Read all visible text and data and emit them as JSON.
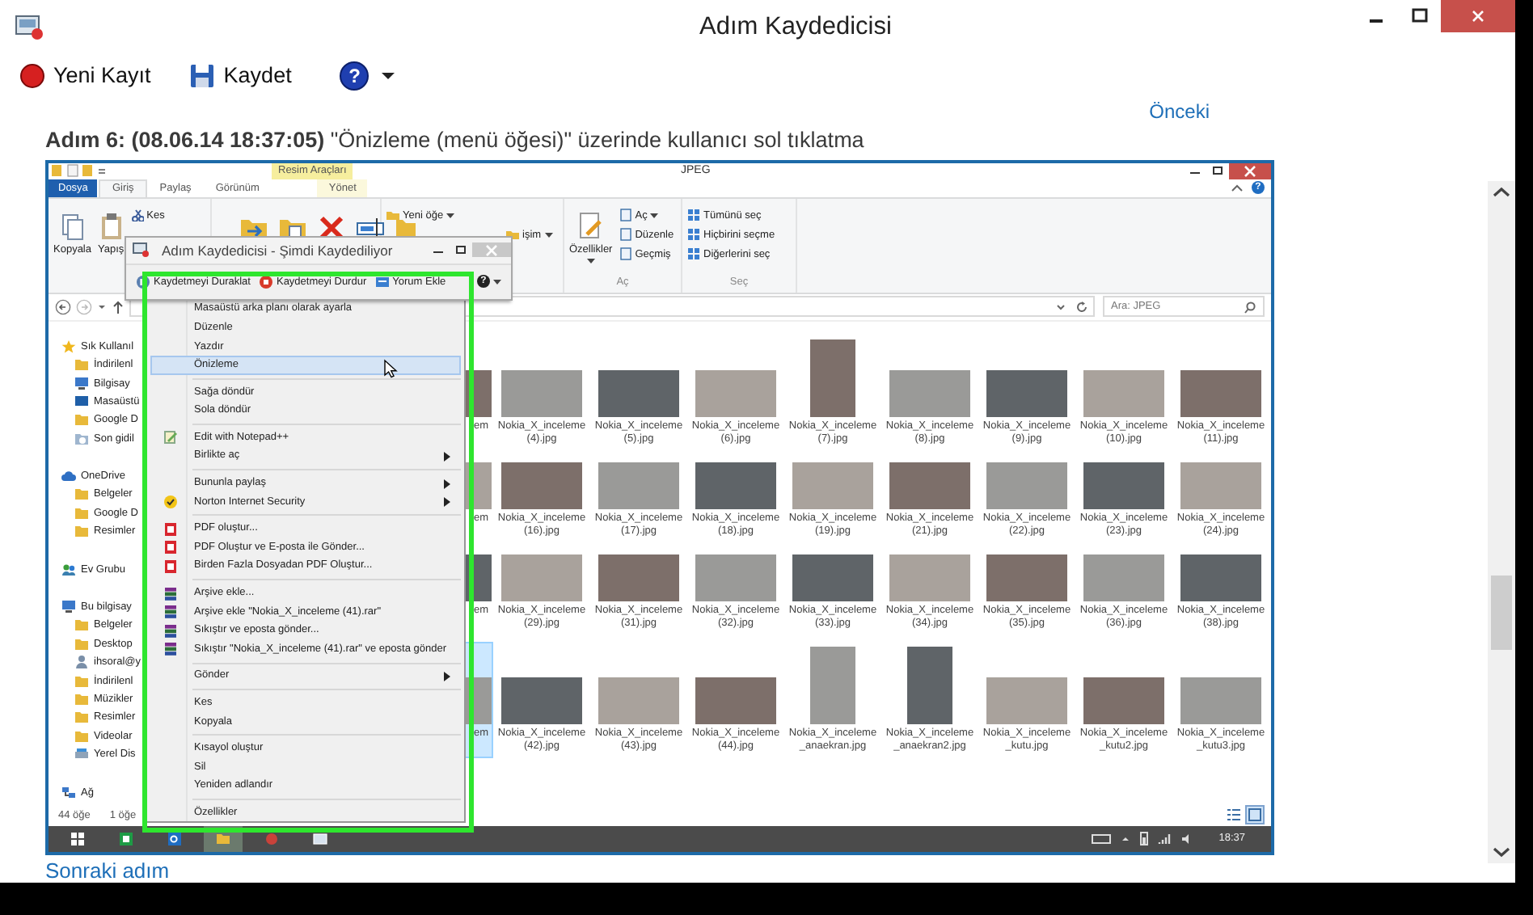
{
  "window": {
    "title": "Adım Kaydedicisi"
  },
  "toolbar": {
    "new_recording": "Yeni Kayıt",
    "save": "Kaydet",
    "help_symbol": "?"
  },
  "step": {
    "previous_link": "Önceki",
    "heading": "**Adım 6: (08.06.14 18:37:05)** \"Önizleme (menü öğesi)\" üzerinde kullanıcı sol tıklatma",
    "next_link": "Sonraki adım"
  },
  "screenshot": {
    "explorer": {
      "title": "JPEG",
      "context_tab": "Resim Araçları",
      "help_symbol": "?",
      "tabs": [
        {
          "label": "Dosya",
          "kind": "file",
          "selected": false
        },
        {
          "label": "Giriş",
          "kind": "tab",
          "selected": true
        },
        {
          "label": "Paylaş",
          "kind": "tab",
          "selected": false
        },
        {
          "label": "Görünüm",
          "kind": "tab",
          "selected": false
        },
        {
          "label": "Yönet",
          "kind": "context",
          "selected": false
        }
      ],
      "ribbon": [
        {
          "kind": "clipboard",
          "items": [
            {
              "label": "Kopyala",
              "kind": "large",
              "dropdown": false
            },
            {
              "label": "Yapış",
              "kind": "large",
              "dropdown": false
            },
            {
              "label": "Kes",
              "kind": "small",
              "dropdown": false
            }
          ]
        },
        {
          "kind": "organize"
        },
        {
          "kind": "new",
          "items": [
            {
              "label": "Yeni öğe",
              "kind": "small",
              "dropdown": true
            },
            {
              "label": "işim",
              "kind": "small",
              "dropdown": true
            }
          ]
        },
        {
          "kind": "open",
          "caption": "Aç",
          "items": [
            {
              "label": "Özellikler",
              "kind": "large",
              "dropdown": true
            },
            {
              "label": "Aç",
              "kind": "small",
              "dropdown": true
            },
            {
              "label": "Düzenle",
              "kind": "small",
              "dropdown": false
            },
            {
              "label": "Geçmiş",
              "kind": "small",
              "dropdown": false
            }
          ]
        },
        {
          "kind": "select",
          "caption": "Seç",
          "items": [
            {
              "label": "Tümünü seç",
              "kind": "small",
              "dropdown": false
            },
            {
              "label": "Hiçbirini seçme",
              "kind": "small",
              "dropdown": false
            },
            {
              "label": "Diğerlerini seç",
              "kind": "small",
              "dropdown": false
            }
          ]
        }
      ],
      "search_placeholder": "Ara: JPEG",
      "navigation": [
        {
          "label": "Sık Kullanıl",
          "kind": "star",
          "children": [
            {
              "label": "İndirilenl",
              "kind": "folder"
            },
            {
              "label": "Bilgisay",
              "kind": "computer"
            },
            {
              "label": "Masaüstü",
              "kind": "desktop"
            },
            {
              "label": "Google D",
              "kind": "folder"
            },
            {
              "label": "Son gidil",
              "kind": "recent"
            }
          ]
        },
        {
          "label": "OneDrive",
          "kind": "cloud",
          "children": [
            {
              "label": "Belgeler",
              "kind": "folder"
            },
            {
              "label": "Google D",
              "kind": "folder"
            },
            {
              "label": "Resimler",
              "kind": "folder"
            }
          ]
        },
        {
          "label": "Ev Grubu",
          "kind": "group"
        },
        {
          "label": "Bu bilgisay",
          "kind": "computer",
          "children": [
            {
              "label": "Belgeler",
              "kind": "folder"
            },
            {
              "label": "Desktop",
              "kind": "folder"
            },
            {
              "label": "ihsoral@y",
              "kind": "user"
            },
            {
              "label": "İndirilenl",
              "kind": "folder"
            },
            {
              "label": "Müzikler",
              "kind": "folder"
            },
            {
              "label": "Resimler",
              "kind": "folder"
            },
            {
              "label": "Videolar",
              "kind": "folder"
            },
            {
              "label": "Yerel Dis",
              "kind": "drive"
            }
          ]
        },
        {
          "label": "Ağ",
          "kind": "network"
        }
      ],
      "files": [
        [
          {
            "label": "em",
            "kind": "peek",
            "selected": false
          },
          {
            "label": "Nokia_X_inceleme (4).jpg",
            "kind": "landscape",
            "selected": false
          },
          {
            "label": "Nokia_X_inceleme (5).jpg",
            "kind": "landscape",
            "selected": false
          },
          {
            "label": "Nokia_X_inceleme (6).jpg",
            "kind": "landscape",
            "selected": false
          },
          {
            "label": "Nokia_X_inceleme (7).jpg",
            "kind": "portrait",
            "selected": false
          },
          {
            "label": "Nokia_X_inceleme (8).jpg",
            "kind": "landscape",
            "selected": false
          },
          {
            "label": "Nokia_X_inceleme (9).jpg",
            "kind": "landscape",
            "selected": false
          },
          {
            "label": "Nokia_X_inceleme (10).jpg",
            "kind": "landscape",
            "selected": false
          },
          {
            "label": "Nokia_X_inceleme (11).jpg",
            "kind": "landscape",
            "selected": false
          }
        ],
        [
          {
            "label": "em",
            "kind": "peek",
            "selected": false
          },
          {
            "label": "Nokia_X_inceleme (16).jpg",
            "kind": "landscape",
            "selected": false
          },
          {
            "label": "Nokia_X_inceleme (17).jpg",
            "kind": "landscape",
            "selected": false
          },
          {
            "label": "Nokia_X_inceleme (18).jpg",
            "kind": "landscape",
            "selected": false
          },
          {
            "label": "Nokia_X_inceleme (19).jpg",
            "kind": "landscape",
            "selected": false
          },
          {
            "label": "Nokia_X_inceleme (21).jpg",
            "kind": "landscape",
            "selected": false
          },
          {
            "label": "Nokia_X_inceleme (22).jpg",
            "kind": "landscape",
            "selected": false
          },
          {
            "label": "Nokia_X_inceleme (23).jpg",
            "kind": "landscape",
            "selected": false
          },
          {
            "label": "Nokia_X_inceleme (24).jpg",
            "kind": "landscape",
            "selected": false
          }
        ],
        [
          {
            "label": "em",
            "kind": "peek",
            "selected": false
          },
          {
            "label": "Nokia_X_inceleme (29).jpg",
            "kind": "landscape",
            "selected": false
          },
          {
            "label": "Nokia_X_inceleme (31).jpg",
            "kind": "landscape",
            "selected": false
          },
          {
            "label": "Nokia_X_inceleme (32).jpg",
            "kind": "landscape",
            "selected": false
          },
          {
            "label": "Nokia_X_inceleme (33).jpg",
            "kind": "landscape",
            "selected": false
          },
          {
            "label": "Nokia_X_inceleme (34).jpg",
            "kind": "landscape",
            "selected": false
          },
          {
            "label": "Nokia_X_inceleme (35).jpg",
            "kind": "landscape",
            "selected": false
          },
          {
            "label": "Nokia_X_inceleme (36).jpg",
            "kind": "landscape",
            "selected": false
          },
          {
            "label": "Nokia_X_inceleme (38).jpg",
            "kind": "landscape",
            "selected": false
          }
        ],
        [
          {
            "label": "em",
            "kind": "peek",
            "selected": true
          },
          {
            "label": "Nokia_X_inceleme (42).jpg",
            "kind": "landscape",
            "selected": false
          },
          {
            "label": "Nokia_X_inceleme (43).jpg",
            "kind": "landscape",
            "selected": false
          },
          {
            "label": "Nokia_X_inceleme (44).jpg",
            "kind": "landscape",
            "selected": false
          },
          {
            "label": "Nokia_X_inceleme_anaekran.jpg",
            "kind": "portrait",
            "selected": false
          },
          {
            "label": "Nokia_X_inceleme_anaekran2.jpg",
            "kind": "portrait",
            "selected": false
          },
          {
            "label": "Nokia_X_inceleme_kutu.jpg",
            "kind": "landscape",
            "selected": false
          },
          {
            "label": "Nokia_X_inceleme_kutu2.jpg",
            "kind": "landscape",
            "selected": false
          },
          {
            "label": "Nokia_X_inceleme_kutu3.jpg",
            "kind": "landscape",
            "selected": false
          }
        ]
      ],
      "status": [
        "44 öğe",
        "1 öğe"
      ],
      "views": [
        {
          "kind": "details",
          "selected": false
        },
        {
          "kind": "icons",
          "selected": true
        }
      ]
    },
    "recorder": {
      "title": "Adım Kaydedicisi - Şimdi Kaydediliyor",
      "help_symbol": "?",
      "buttons": [
        {
          "label": "Kaydetmeyi Duraklat",
          "kind": "pause"
        },
        {
          "label": "Kaydetmeyi Durdur",
          "kind": "stop"
        },
        {
          "label": "Yorum Ekle",
          "kind": "comment"
        }
      ]
    },
    "context_menu": [
      [
        {
          "label": "Masaüstü arka planı olarak ayarla",
          "kind": "plain",
          "submenu": false,
          "selected": false
        },
        {
          "label": "Düzenle",
          "kind": "plain",
          "submenu": false,
          "selected": false
        },
        {
          "label": "Yazdır",
          "kind": "plain",
          "submenu": false,
          "selected": false
        },
        {
          "label": "Önizleme",
          "kind": "plain",
          "submenu": false,
          "selected": true
        }
      ],
      [
        {
          "label": "Sağa döndür",
          "kind": "plain",
          "submenu": false,
          "selected": false
        },
        {
          "label": "Sola döndür",
          "kind": "plain",
          "submenu": false,
          "selected": false
        }
      ],
      [
        {
          "label": "Edit with Notepad++",
          "kind": "notepad",
          "submenu": false,
          "selected": false
        },
        {
          "label": "Birlikte aç",
          "kind": "plain",
          "submenu": true,
          "selected": false
        }
      ],
      [
        {
          "label": "Bununla paylaş",
          "kind": "plain",
          "submenu": true,
          "selected": false
        },
        {
          "label": "Norton Internet Security",
          "kind": "norton",
          "submenu": true,
          "selected": false
        }
      ],
      [
        {
          "label": "PDF oluştur...",
          "kind": "pdf",
          "submenu": false,
          "selected": false
        },
        {
          "label": "PDF Oluştur ve E-posta ile Gönder...",
          "kind": "pdf",
          "submenu": false,
          "selected": false
        },
        {
          "label": "Birden Fazla Dosyadan PDF Oluştur...",
          "kind": "pdf",
          "submenu": false,
          "selected": false
        }
      ],
      [
        {
          "label": "Arşive ekle...",
          "kind": "archive",
          "submenu": false,
          "selected": false
        },
        {
          "label": "Arşive ekle \"Nokia_X_inceleme (41).rar\"",
          "kind": "archive",
          "submenu": false,
          "selected": false
        },
        {
          "label": "Sıkıştır ve eposta gönder...",
          "kind": "archive",
          "submenu": false,
          "selected": false
        },
        {
          "label": "Sıkıştır \"Nokia_X_inceleme (41).rar\" ve eposta gönder",
          "kind": "archive",
          "submenu": false,
          "selected": false
        }
      ],
      [
        {
          "label": "Gönder",
          "kind": "plain",
          "submenu": true,
          "selected": false
        }
      ],
      [
        {
          "label": "Kes",
          "kind": "plain",
          "submenu": false,
          "selected": false
        },
        {
          "label": "Kopyala",
          "kind": "plain",
          "submenu": false,
          "selected": false
        }
      ],
      [
        {
          "label": "Kısayol oluştur",
          "kind": "plain",
          "submenu": false,
          "selected": false
        },
        {
          "label": "Sil",
          "kind": "plain",
          "submenu": false,
          "selected": false
        },
        {
          "label": "Yeniden adlandır",
          "kind": "plain",
          "submenu": false,
          "selected": false
        }
      ],
      [
        {
          "label": "Özellikler",
          "kind": "plain",
          "submenu": false,
          "selected": false
        }
      ]
    ],
    "taskbar": {
      "apps": [
        {
          "kind": "start",
          "selected": false
        },
        {
          "kind": "sheet",
          "selected": false
        },
        {
          "kind": "mail",
          "selected": false
        },
        {
          "kind": "explorer",
          "selected": true
        },
        {
          "kind": "media",
          "selected": false
        },
        {
          "kind": "window",
          "selected": false
        }
      ],
      "clock": "18:37"
    }
  }
}
